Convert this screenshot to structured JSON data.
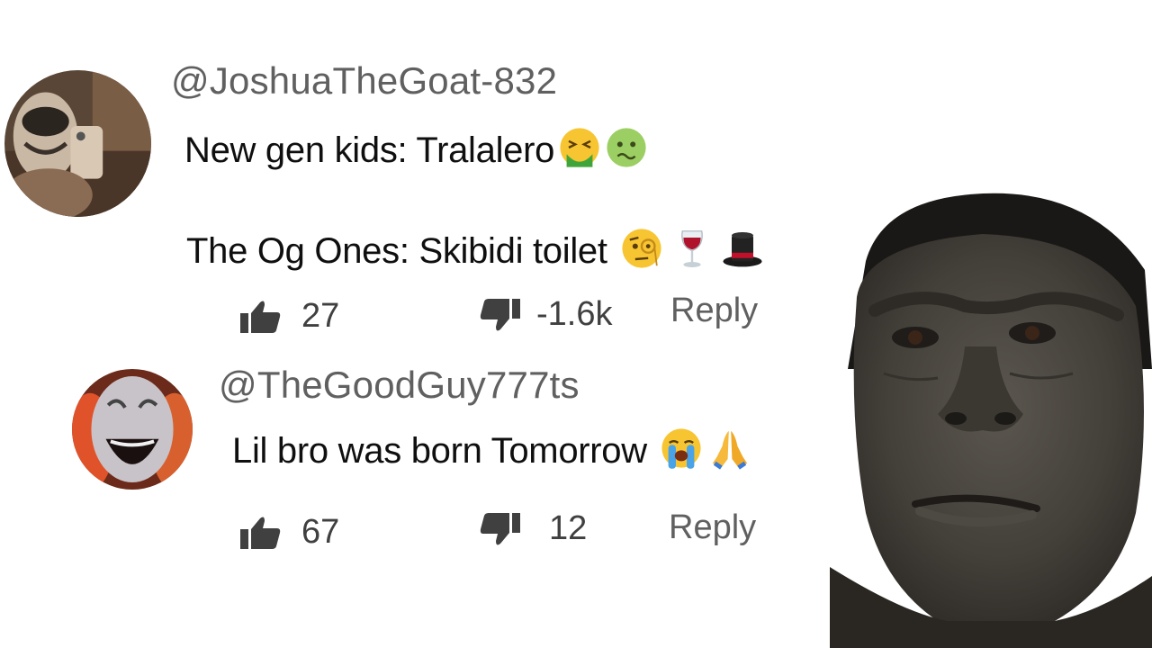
{
  "comments": [
    {
      "handle": "@JoshuaTheGoat-832",
      "line1": "New gen kids: Tralalero",
      "line1_emojis": [
        "nauseated-face-emoji",
        "sick-face-emoji"
      ],
      "line2": "The Og Ones: Skibidi toilet",
      "line2_emojis": [
        "monocle-face-emoji",
        "wine-glass-emoji",
        "top-hat-emoji"
      ],
      "likes": "27",
      "dislikes": "-1.6k",
      "reply_label": "Reply"
    },
    {
      "handle": "@TheGoodGuy777ts",
      "line1": "Lil bro was born Tomorrow",
      "line1_emojis": [
        "loudly-crying-face-emoji",
        "folded-hands-emoji"
      ],
      "likes": "67",
      "dislikes": "12",
      "reply_label": "Reply"
    }
  ],
  "icons": {
    "like": "thumbs-up-icon",
    "dislike": "thumbs-down-icon"
  },
  "colors": {
    "text": "#0f0f0f",
    "handle": "#606060",
    "background": "#ffffff"
  }
}
